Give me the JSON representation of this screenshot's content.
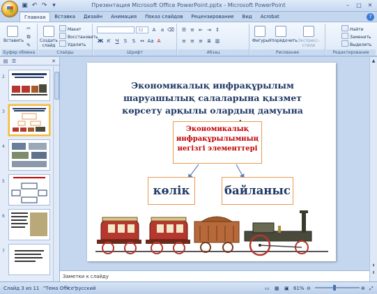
{
  "app": {
    "window_title": "Презентация Microsoft Office PowerPoint.pptx - Microsoft PowerPoint"
  },
  "tabs": [
    "Главная",
    "Вставка",
    "Дизайн",
    "Анимация",
    "Показ слайдов",
    "Рецензирование",
    "Вид",
    "Acrobat"
  ],
  "ribbon": {
    "clipboard": {
      "paste_label": "Вставить",
      "group_label": "Буфер обмена"
    },
    "slides": {
      "new_slide_label": "Создать слайд",
      "layout_label": "Макет",
      "reset_label": "Восстановить",
      "delete_label": "Удалить",
      "group_label": "Слайды"
    },
    "font": {
      "font_size": "32",
      "group_label": "Шрифт"
    },
    "paragraph": {
      "group_label": "Абзац"
    },
    "drawing": {
      "shapes_label": "Фигуры",
      "arrange_label": "Упорядочить",
      "quick_styles_label": "Экспресс-стили",
      "group_label": "Рисование"
    },
    "editing": {
      "find_label": "Найти",
      "replace_label": "Заменить",
      "select_label": "Выделить",
      "group_label": "Редактирование"
    }
  },
  "thumbnails": [
    {
      "number": "2"
    },
    {
      "number": "3"
    },
    {
      "number": "4"
    },
    {
      "number": "5"
    },
    {
      "number": "6"
    },
    {
      "number": "7"
    }
  ],
  "slide": {
    "heading": "Экономикалық инфрақұрылым шаруашылық салаларына қызмет көрсету арқылы олардың дамуына ықпал етеді.",
    "center_box": "Экономикалық инфрақұрылымның негізгі элементтері",
    "box_left": "көлік",
    "box_right": "байланыс"
  },
  "notes_placeholder": "Заметки к слайду",
  "status": {
    "slide_info": "Слайд 3 из 11",
    "theme": "\"Тема Office\"",
    "language": "русский",
    "zoom": "61%"
  }
}
